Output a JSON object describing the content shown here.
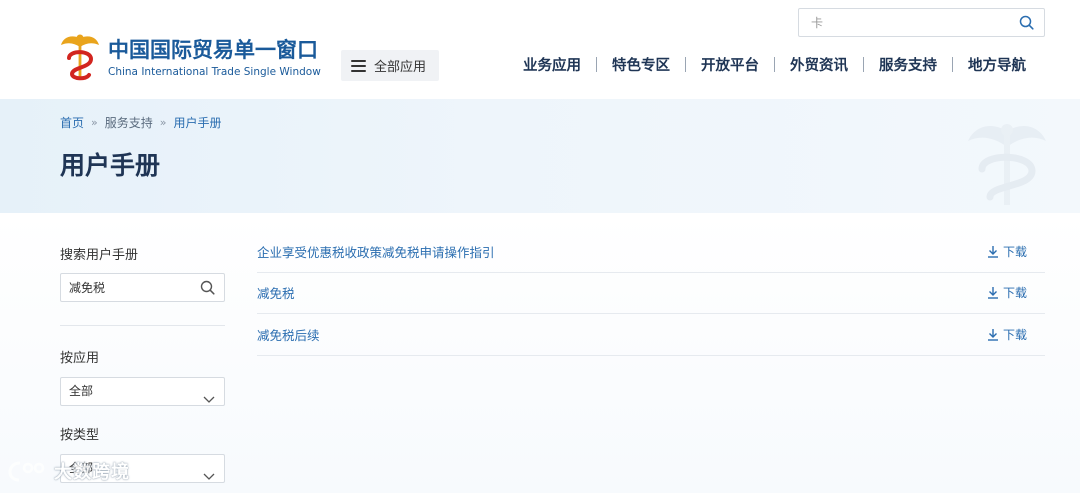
{
  "header": {
    "logo_cn": "中国国际贸易单一窗口",
    "logo_en": "China International Trade Single Window",
    "all_apps_label": "全部应用",
    "search_value": "卡",
    "nav": [
      "业务应用",
      "特色专区",
      "开放平台",
      "外贸资讯",
      "服务支持",
      "地方导航"
    ]
  },
  "banner": {
    "breadcrumb": [
      "首页",
      "服务支持",
      "用户手册"
    ],
    "title": "用户手册"
  },
  "sidebar": {
    "search_label": "搜索用户手册",
    "search_value": "减免税",
    "by_app_label": "按应用",
    "by_app_value": "全部",
    "by_type_label": "按类型",
    "by_type_value": "全部"
  },
  "list": {
    "download_label": "下载",
    "items": [
      {
        "title": "企业享受优惠税收政策减免税申请操作指引"
      },
      {
        "title": "减免税"
      },
      {
        "title": "减免税后续"
      }
    ]
  },
  "watermark": "大数跨境",
  "colors": {
    "primary": "#2a6db0",
    "nav": "#1f3555",
    "banner": "#e6f1f9"
  }
}
